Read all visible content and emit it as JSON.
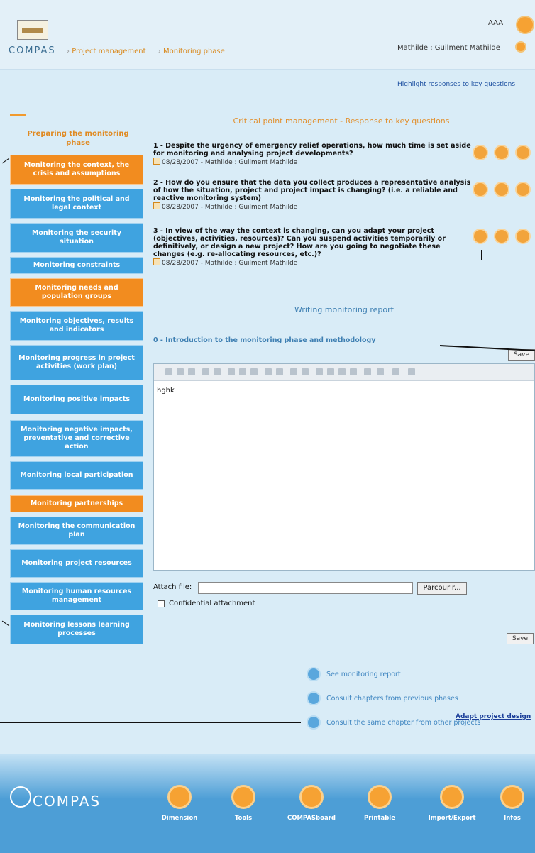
{
  "header": {
    "logo_text": "COMPAS",
    "breadcrumb": [
      "Project management",
      "Monitoring phase"
    ],
    "user_code": "AAA",
    "user_name": "Mathilde : Guilment Mathilde"
  },
  "highlight_link": "Highlight responses to key questions",
  "sidebar": {
    "title": "Preparing the monitoring phase",
    "items": [
      {
        "label": "Monitoring the context, the crisis and assumptions",
        "color": "orange"
      },
      {
        "label": "Monitoring the political and legal context",
        "color": "blue"
      },
      {
        "label": "Monitoring the security situation",
        "color": "blue"
      },
      {
        "label": "Monitoring constraints",
        "color": "blue"
      },
      {
        "label": "Monitoring needs and population groups",
        "color": "orange"
      },
      {
        "label": "Monitoring objectives, results and indicators",
        "color": "blue"
      },
      {
        "label": "Monitoring progress in project activities (work plan)",
        "color": "blue"
      },
      {
        "label": "Monitoring positive impacts",
        "color": "blue"
      },
      {
        "label": "Monitoring negative impacts, preventative and corrective action",
        "color": "blue"
      },
      {
        "label": "Monitoring local participation",
        "color": "blue"
      },
      {
        "label": "Monitoring partnerships",
        "color": "orange"
      },
      {
        "label": "Monitoring the communication plan",
        "color": "blue"
      },
      {
        "label": "Monitoring project resources",
        "color": "blue"
      },
      {
        "label": "Monitoring human resources management",
        "color": "blue"
      },
      {
        "label": "Monitoring lessons learning processes",
        "color": "blue"
      }
    ]
  },
  "content": {
    "title": "Critical point management - Response to key questions",
    "questions": [
      {
        "text": "1 - Despite the urgency of emergency relief operations, how much time is set aside for monitoring and analysing project developments?",
        "meta": "08/28/2007 - Mathilde : Guilment Mathilde"
      },
      {
        "text": "2 - How do you ensure that the data you collect produces a representative analysis of how the situation, project and project impact is changing? (i.e. a reliable and reactive monitoring system)",
        "meta": "08/28/2007 - Mathilde : Guilment Mathilde"
      },
      {
        "text": "3 - In view of the way the context is changing, can you adapt your project (objectives, activities, resources)? Can you suspend activities temporarily or definitively, or design a new project? How are you going to negotiate these changes (e.g. re-allocating resources, etc.)?",
        "meta": "08/28/2007 - Mathilde : Guilment Mathilde"
      }
    ],
    "report_title": "Writing monitoring report",
    "section_title": "0 - Introduction to the monitoring phase and methodology",
    "save_label": "Save",
    "editor_text": "hghk",
    "attach_label": "Attach file:",
    "browse_label": "Parcourir...",
    "confidential_label": "Confidential attachment",
    "links": [
      "See monitoring report",
      "Consult chapters from previous phases",
      "Consult the same chapter from other projects"
    ],
    "adapt_link": "Adapt project design"
  },
  "footer": {
    "logo_text": "COMPAS",
    "items": [
      "Dimension",
      "Tools",
      "COMPASboard",
      "Printable",
      "Import/Export",
      "Infos"
    ]
  }
}
